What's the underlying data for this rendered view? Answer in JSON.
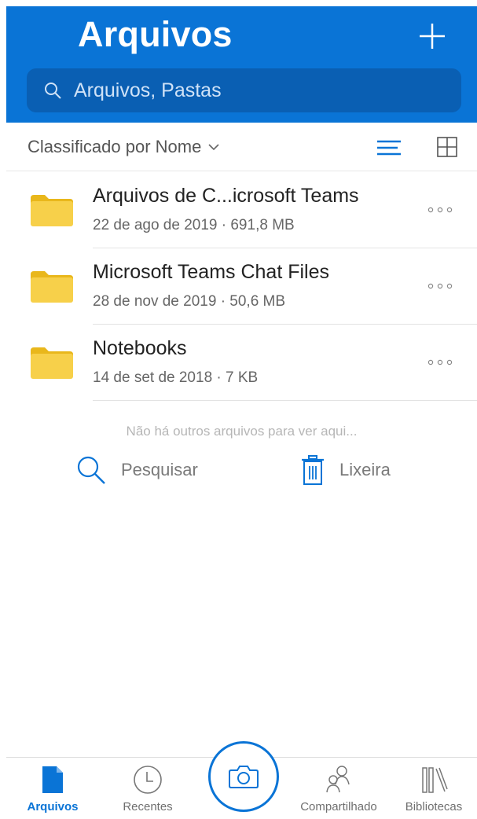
{
  "header": {
    "title": "Arquivos",
    "search_placeholder": "Arquivos, Pastas"
  },
  "sortbar": {
    "sort_label": "Classificado por Nome"
  },
  "files": [
    {
      "name": "Arquivos de C...icrosoft Teams",
      "meta": "22 de ago de 2019 · 691,8 MB",
      "icon": "folder-icon"
    },
    {
      "name": "Microsoft Teams Chat Files",
      "meta": "28 de nov de 2019 · 50,6 MB",
      "icon": "folder-icon"
    },
    {
      "name": "Notebooks",
      "meta": "14 de set de 2018 · 7 KB",
      "icon": "folder-icon"
    }
  ],
  "empty_note": "Não há outros arquivos para ver aqui...",
  "actions": {
    "search_label": "Pesquisar",
    "trash_label": "Lixeira"
  },
  "tabs": [
    {
      "label": "Arquivos",
      "icon": "file-icon",
      "active": true
    },
    {
      "label": "Recentes",
      "icon": "clock-icon",
      "active": false
    },
    {
      "label": "Compartilhado",
      "icon": "people-icon",
      "active": false
    },
    {
      "label": "Bibliotecas",
      "icon": "library-icon",
      "active": false
    }
  ],
  "colors": {
    "accent": "#0a74d6",
    "search_bg": "#0a5fb3",
    "folder": "#f7d04a",
    "folder_tab": "#e9b71b"
  }
}
